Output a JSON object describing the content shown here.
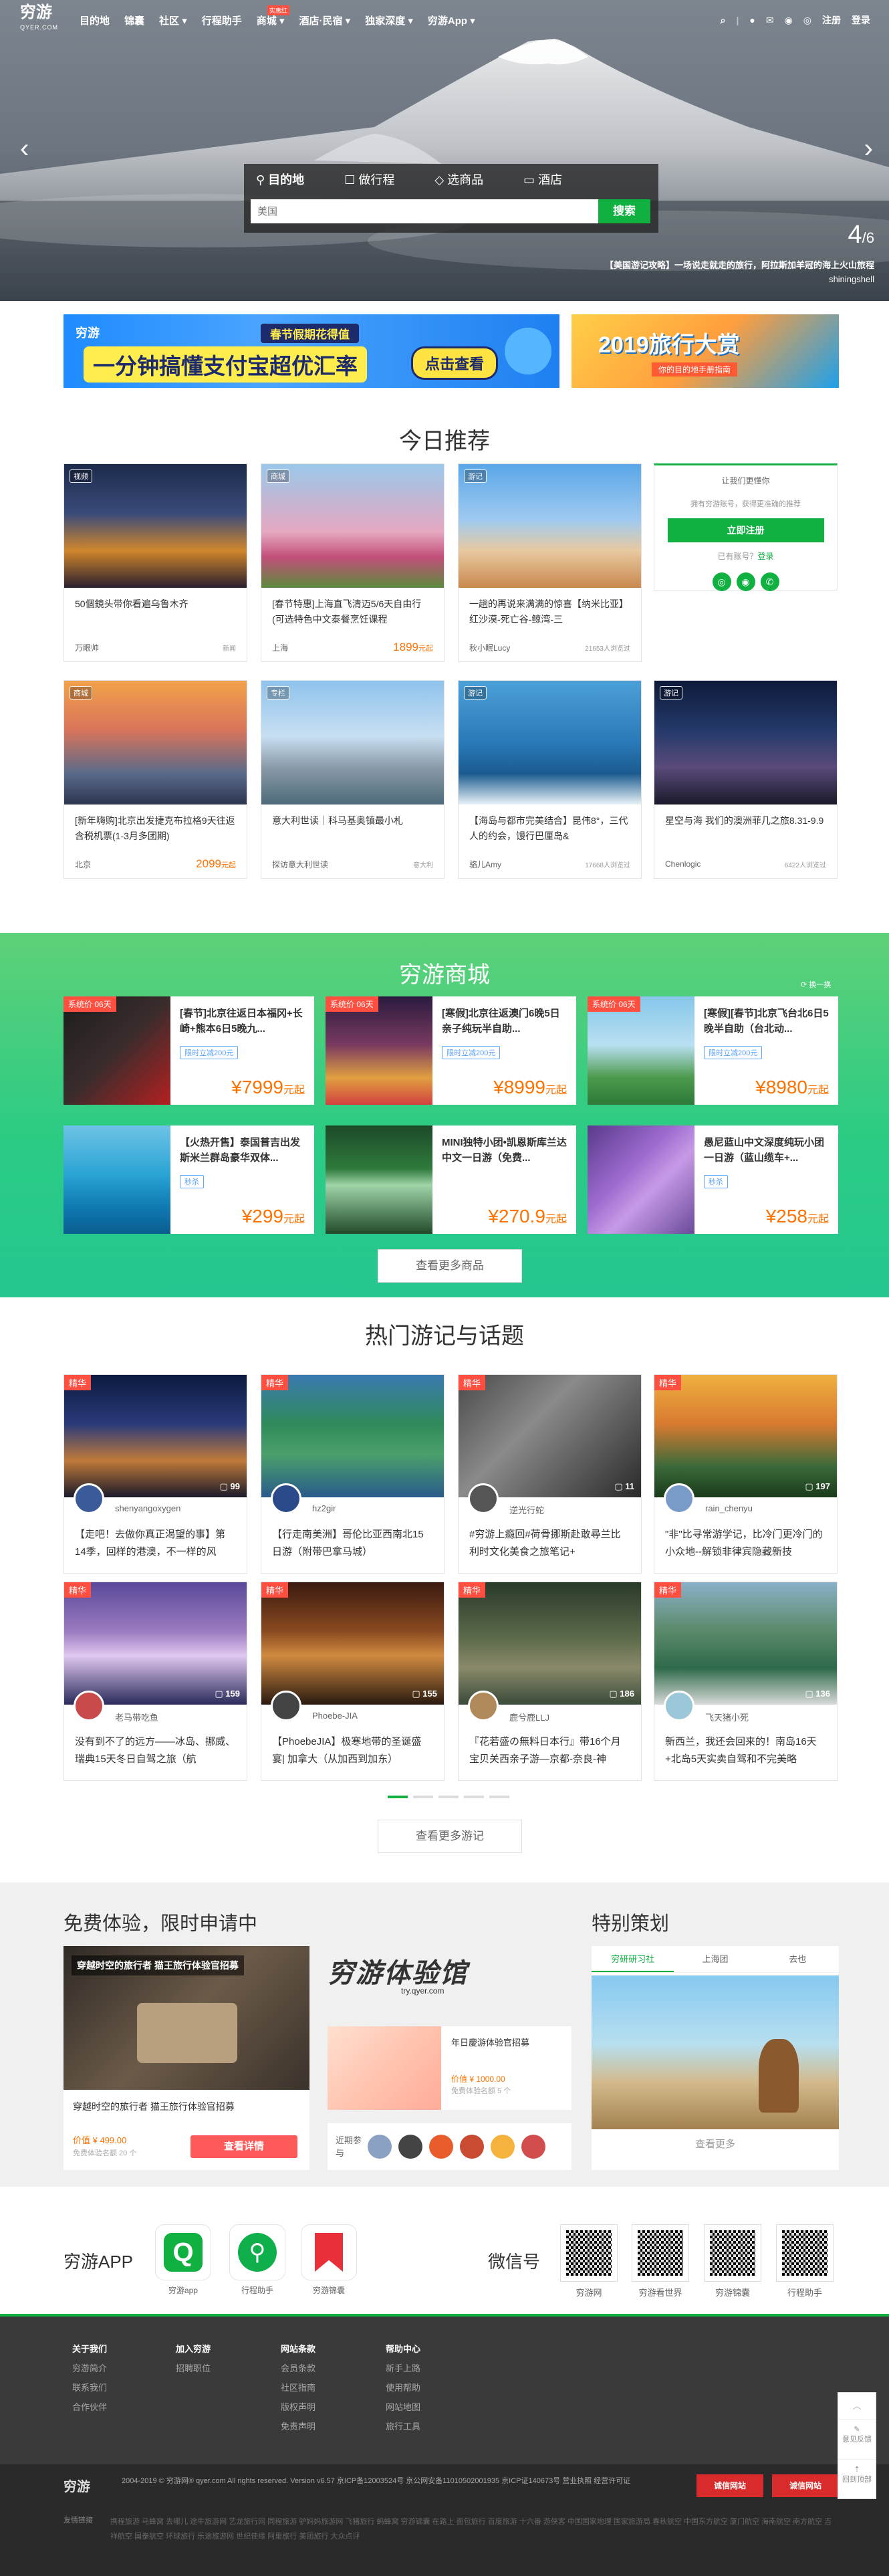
{
  "nav": {
    "logo": "穷游",
    "logo_sub": "QYER.COM",
    "items": [
      "目的地",
      "锦囊",
      "社区",
      "行程助手",
      "商城",
      "酒店·民宿",
      "独家深度",
      "穷游App"
    ],
    "mall_badge": "实惠红",
    "right": {
      "register": "注册",
      "login": "登录"
    }
  },
  "hero": {
    "search_tabs": [
      "目的地",
      "做行程",
      "选商品",
      "酒店"
    ],
    "search_placeholder": "美国",
    "search_button": "搜索",
    "counter_current": "4",
    "counter_total": "/6",
    "caption_line1": "【美国游记攻略】一场说走就走的旅行，阿拉斯加羊冠的海上火山旅程",
    "caption_line2": "shiningshell"
  },
  "banners": {
    "b1_title": "春节假期花得值",
    "b1_sub": "一分钟搞懂支付宝超优汇率",
    "b1_button": "点击查看",
    "b1_logo": "穷游",
    "b2_title": "2019旅行大赏",
    "b2_sub": "你的目的地手册指南"
  },
  "today": {
    "title": "今日推荐",
    "cards": [
      {
        "tag": "视频",
        "title": "50個鏡头带你看遍乌鲁木齐",
        "author": "万眼帅",
        "right": "新闻",
        "price": ""
      },
      {
        "tag": "商城",
        "title": "[春节特惠]上海直飞清迈5/6天自由行(可选特色中文泰餐烹饪课程",
        "author": "上海",
        "right": "",
        "price": "1899",
        "unit": "元起"
      },
      {
        "tag": "游记",
        "title": "一趟的再说来满满的惊喜【纳米比亚】红沙漠-死亡谷-鲸湾-三",
        "author": "秋小眠Lucy",
        "right": "21653人浏览过",
        "price": ""
      },
      {
        "tag": "商城",
        "title": "[新年嗨购]北京出发捷克布拉格9天往返含税机票(1-3月多团期)",
        "author": "北京",
        "right": "",
        "price": "2099",
        "unit": "元起"
      },
      {
        "tag": "专栏",
        "title": "意大利世读｜科马基奥镇最小札",
        "author": "探访意大利世读",
        "right": "意大利",
        "price": ""
      },
      {
        "tag": "游记",
        "title": "【海岛与都市完美结合】昆伟8°，三代人的约会，馒行巴厘岛&",
        "author": "骆儿Amy",
        "right": "17668人浏览过",
        "price": ""
      },
      {
        "tag": "游记",
        "title": "星空与海 我们的澳洲菲几之旅8.31-9.9",
        "author": "Chenlogic",
        "right": "6422人浏览过",
        "price": ""
      }
    ],
    "login_box": {
      "hello": "让我们更懂你",
      "desc": "拥有穷游账号，获得更准确的推荐",
      "register": "立即注册",
      "have_account": "已有账号？",
      "login": "登录"
    }
  },
  "mall": {
    "title": "穷游商城",
    "refresh": "换一换",
    "items": [
      {
        "badge": "系统价 06天",
        "title": "[春节]北京往返日本福冈+长崎+熊本6日5晚九...",
        "label": "限时立减200元",
        "price": "7999",
        "unit": "元起"
      },
      {
        "badge": "系统价 06天",
        "title": "[寒假]北京往返澳门6晚5日亲子纯玩半自助...",
        "label": "限时立减200元",
        "price": "8999",
        "unit": "元起"
      },
      {
        "badge": "系统价 06天",
        "title": "[寒假][春节]北京飞台北6日5晚半自助（台北动...",
        "label": "限时立减200元",
        "price": "8980",
        "unit": "元起"
      },
      {
        "badge": "",
        "title": "【火热开售】泰国普吉出发斯米兰群岛豪华双体...",
        "label": "秒杀",
        "price": "299",
        "unit": "元起"
      },
      {
        "badge": "",
        "title": "MINI独特小团•凯恩斯库兰达中文一日游（免费...",
        "label": "",
        "price": "270.9",
        "unit": "元起"
      },
      {
        "badge": "",
        "title": "愚尼蓝山中文深度纯玩小团一日游（蓝山缆车+...",
        "label": "秒杀",
        "price": "258",
        "unit": "元起"
      }
    ],
    "more": "查看更多商品"
  },
  "topics": {
    "title": "热门游记与话题",
    "jing": "精华",
    "cards": [
      {
        "user": "shenyangoxygen",
        "count": "99",
        "title": "【走吧！去做你真正渴望的事】第14季，回样的港澳，不一样的风"
      },
      {
        "user": "hz2gir",
        "count": "",
        "title": "【行走南美洲】哥伦比亚西南北15日游（附带巴拿马城）"
      },
      {
        "user": "逆光行蛇",
        "count": "11",
        "title": "#穷游上瘾回#荷骨挪斯赴敢尋兰比利时文化美食之旅笔记+"
      },
      {
        "user": "rain_chenyu",
        "count": "197",
        "title": "\"非\"比寻常游学记，比冷门更冷门的小众地--解锁非律宾隐藏新技"
      },
      {
        "user": "老马带吃鱼",
        "count": "159",
        "title": "没有到不了的远方——冰岛、挪威、瑞典15天冬日自驾之旅（航"
      },
      {
        "user": "Phoebe-JIA",
        "count": "155",
        "title": "【PhoebeJIA】极寒地带的圣诞盛宴| 加拿大（从加西到加东）"
      },
      {
        "user": "鹿兮鹿LLJ",
        "count": "186",
        "title": "『花若盛の無料日本行』带16个月宝贝关西亲子游—京都-奈良-神"
      },
      {
        "user": "飞天猪小死",
        "count": "136",
        "title": "新西兰，我还会回来的！南岛16天+北岛5天实卖自驾和不完美略"
      }
    ],
    "more": "查看更多游记"
  },
  "trial": {
    "title": "免费体验，限时申请中",
    "main_title": "穿越时空的旅行者 猫王旅行体验官招募",
    "main_overlay": "穿越时空的旅行者 猫王旅行体验官招募",
    "main_price": "价值 ¥ 499.00",
    "main_meta": "免费体验名额 20 个",
    "apply": "查看详情",
    "logo_text": "穷游体验馆",
    "logo_sub": "try.qyer.com",
    "side_title": "年日慶游体验官招募",
    "side_price": "价值 ¥ 1000.00",
    "side_meta": "免费体验名额 5 个",
    "recent": "近期参与"
  },
  "special": {
    "title": "特别策划",
    "tabs": [
      "穷研研习社",
      "上海团",
      "去也"
    ],
    "more": "查看更多"
  },
  "apps": {
    "title": "穷游APP",
    "items": [
      "穷游app",
      "行程助手",
      "穷游锦囊"
    ],
    "wechat_title": "微信号",
    "qrs": [
      "穷游网",
      "穷游看世界",
      "穷游锦囊",
      "行程助手"
    ]
  },
  "footer": {
    "cols": [
      {
        "head": "关于我们",
        "items": [
          "穷游简介",
          "联系我们",
          "合作伙伴"
        ]
      },
      {
        "head": "加入穷游",
        "items": [
          "招聘职位"
        ]
      },
      {
        "head": "网站条款",
        "items": [
          "会员条款",
          "社区指南",
          "版权声明",
          "免责声明"
        ]
      },
      {
        "head": "帮助中心",
        "items": [
          "新手上路",
          "使用帮助",
          "网站地图",
          "旅行工具"
        ]
      }
    ],
    "copyright": "2004-2019 © 穷游网® qyer.com All rights reserved. Version v6.57 京ICP备12003524号 京公网安备11010502001935 京ICP证140673号 营业执照 经营许可证",
    "links_label": "友情链接",
    "links": "携程旅游 马蜂窝 去哪儿 途牛旅游网 艺龙旅行网 同程旅游 驴妈妈旅游网 飞猪旅行 蚂蜂窝 穷游锦囊 在路上 面包旅行 百度旅游 十六番 游侠客 中国国家地理 国家旅游局 春秋航空 中国东方航空 厦门航空 海南航空 南方航空 吉祥航空 国泰航空 环球旅行 乐途旅游网 世纪佳缘 阿里旅行 美团旅行 大众点评",
    "badges": [
      "诚信网站",
      "诚信网站"
    ]
  },
  "sidebar": [
    "意见反馈",
    "回到顶部"
  ],
  "colors": {
    "accent": "#10b041",
    "price": "#ff7200",
    "badge": "#ff4f40"
  }
}
